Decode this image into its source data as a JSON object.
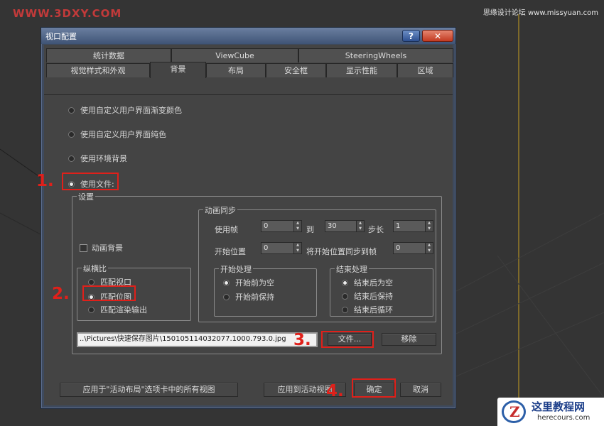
{
  "watermarks": {
    "top_left": "WWW.3DXY.COM",
    "top_right": "思缘设计论坛 www.missyuan.com",
    "logo_title": "这里教程网",
    "logo_url": "herecours.com"
  },
  "dialog": {
    "title": "视口配置",
    "help_label": "?",
    "close_label": "✕"
  },
  "tabs": {
    "row1": [
      "统计数据",
      "ViewCube",
      "SteeringWheels"
    ],
    "row2": [
      "视觉样式和外观",
      "背景",
      "布局",
      "安全框",
      "显示性能",
      "区域"
    ],
    "active": "背景"
  },
  "background_options": [
    {
      "label": "使用自定义用户界面渐变颜色",
      "selected": false
    },
    {
      "label": "使用自定义用户界面纯色",
      "selected": false
    },
    {
      "label": "使用环境背景",
      "selected": false
    },
    {
      "label": "使用文件:",
      "selected": true
    }
  ],
  "settings": {
    "legend": "设置",
    "animate_background_label": "动画背景",
    "animate_background_checked": false,
    "aspect_ratio": {
      "legend": "纵横比",
      "options": [
        {
          "label": "匹配视口",
          "selected": false
        },
        {
          "label": "匹配位图",
          "selected": true
        },
        {
          "label": "匹配渲染输出",
          "selected": false
        }
      ]
    },
    "animation_sync": {
      "legend": "动画同步",
      "use_frame_label": "使用帧",
      "use_frame_value": "0",
      "to_label": "到",
      "to_value": "30",
      "step_label": "步长",
      "step_value": "1",
      "start_position_label": "开始位置",
      "start_position_value": "0",
      "sync_start_label": "将开始位置同步到帧",
      "sync_start_value": "0",
      "start_processing": {
        "legend": "开始处理",
        "options": [
          {
            "label": "开始前为空",
            "selected": true
          },
          {
            "label": "开始前保持",
            "selected": false
          }
        ]
      },
      "end_processing": {
        "legend": "结束处理",
        "options": [
          {
            "label": "结束后为空",
            "selected": true
          },
          {
            "label": "结束后保持",
            "selected": false
          },
          {
            "label": "结束后循环",
            "selected": false
          }
        ]
      }
    }
  },
  "file_path": "..\\Pictures\\快速保存图片\\150105114032077.1000.793.0.jpg",
  "buttons": {
    "files": "文件...",
    "remove": "移除",
    "apply_all": "应用于\"活动布局\"选项卡中的所有视图",
    "apply_active": "应用到活动视图",
    "ok": "确定",
    "cancel": "取消"
  },
  "steps": [
    "1.",
    "2.",
    "3.",
    "4."
  ],
  "colors": {
    "highlight": "#e0201a",
    "dialog_bg": "#444444",
    "title_bar": "#4f6488"
  }
}
